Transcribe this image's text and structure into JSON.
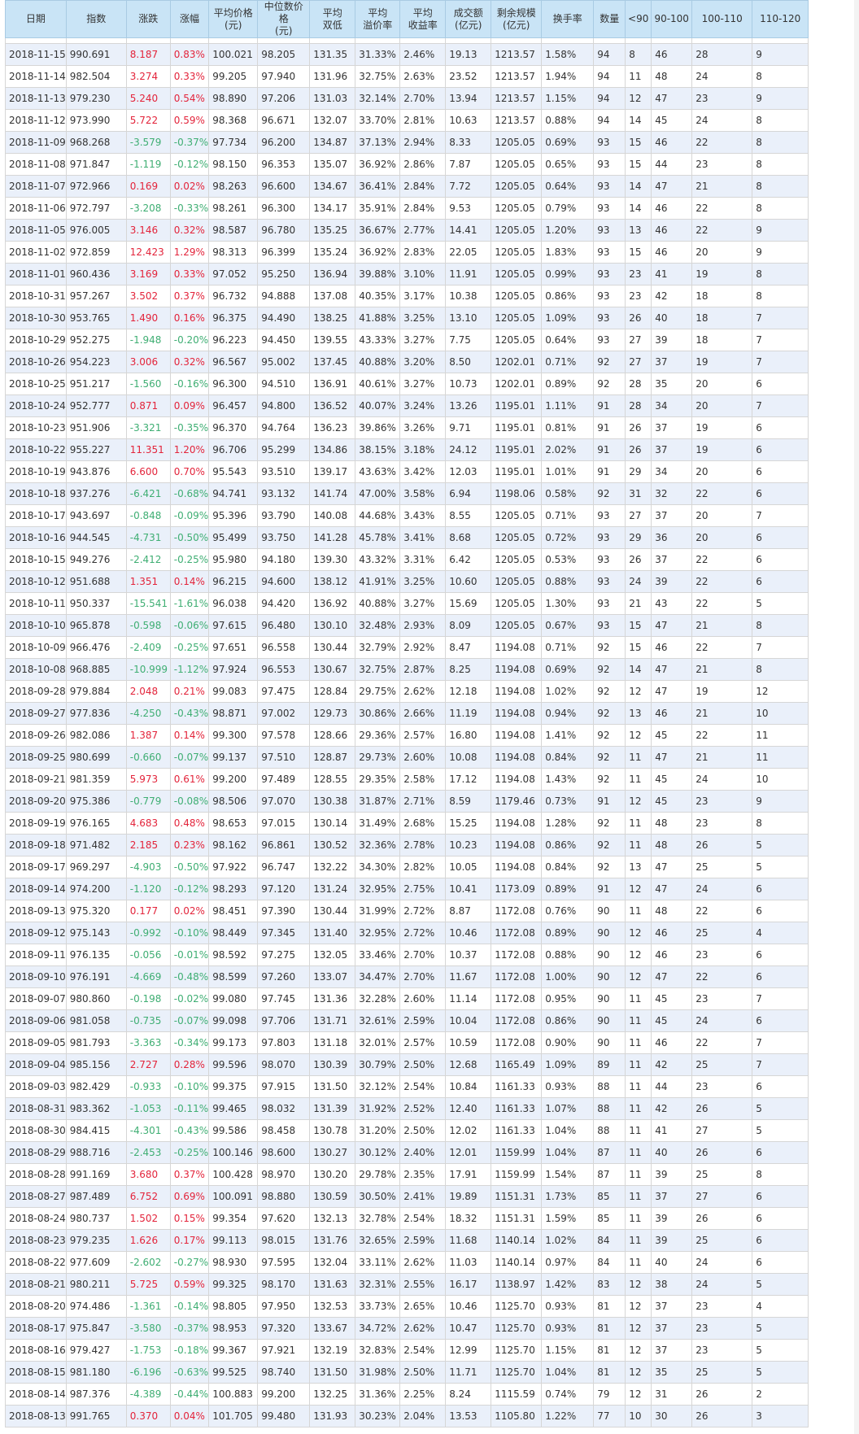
{
  "headers": [
    "日期",
    "指数",
    "涨跌",
    "涨幅",
    "平均价格\n(元)",
    "中位数价格\n(元)",
    "平均\n双低",
    "平均\n溢价率",
    "平均\n收益率",
    "成交额\n(亿元)",
    "剩余规模\n(亿元)",
    "换手率",
    "数量",
    "<90",
    "90-100",
    "100-110",
    "110-120"
  ],
  "rows": [
    [
      "2018-11-15",
      "990.691",
      "8.187",
      "0.83%",
      "100.021",
      "98.205",
      "131.35",
      "31.33%",
      "2.46%",
      "19.13",
      "1213.57",
      "1.58%",
      "94",
      "8",
      "46",
      "28",
      "9"
    ],
    [
      "2018-11-14",
      "982.504",
      "3.274",
      "0.33%",
      "99.205",
      "97.940",
      "131.96",
      "32.75%",
      "2.63%",
      "23.52",
      "1213.57",
      "1.94%",
      "94",
      "11",
      "48",
      "24",
      "8"
    ],
    [
      "2018-11-13",
      "979.230",
      "5.240",
      "0.54%",
      "98.890",
      "97.206",
      "131.03",
      "32.14%",
      "2.70%",
      "13.94",
      "1213.57",
      "1.15%",
      "94",
      "12",
      "47",
      "23",
      "9"
    ],
    [
      "2018-11-12",
      "973.990",
      "5.722",
      "0.59%",
      "98.368",
      "96.671",
      "132.07",
      "33.70%",
      "2.81%",
      "10.63",
      "1213.57",
      "0.88%",
      "94",
      "14",
      "45",
      "24",
      "8"
    ],
    [
      "2018-11-09",
      "968.268",
      "-3.579",
      "-0.37%",
      "97.734",
      "96.200",
      "134.87",
      "37.13%",
      "2.94%",
      "8.33",
      "1205.05",
      "0.69%",
      "93",
      "15",
      "46",
      "22",
      "8"
    ],
    [
      "2018-11-08",
      "971.847",
      "-1.119",
      "-0.12%",
      "98.150",
      "96.353",
      "135.07",
      "36.92%",
      "2.86%",
      "7.87",
      "1205.05",
      "0.65%",
      "93",
      "15",
      "44",
      "23",
      "8"
    ],
    [
      "2018-11-07",
      "972.966",
      "0.169",
      "0.02%",
      "98.263",
      "96.600",
      "134.67",
      "36.41%",
      "2.84%",
      "7.72",
      "1205.05",
      "0.64%",
      "93",
      "14",
      "47",
      "21",
      "8"
    ],
    [
      "2018-11-06",
      "972.797",
      "-3.208",
      "-0.33%",
      "98.261",
      "96.300",
      "134.17",
      "35.91%",
      "2.84%",
      "9.53",
      "1205.05",
      "0.79%",
      "93",
      "14",
      "46",
      "22",
      "8"
    ],
    [
      "2018-11-05",
      "976.005",
      "3.146",
      "0.32%",
      "98.587",
      "96.780",
      "135.25",
      "36.67%",
      "2.77%",
      "14.41",
      "1205.05",
      "1.20%",
      "93",
      "13",
      "46",
      "22",
      "9"
    ],
    [
      "2018-11-02",
      "972.859",
      "12.423",
      "1.29%",
      "98.313",
      "96.399",
      "135.24",
      "36.92%",
      "2.83%",
      "22.05",
      "1205.05",
      "1.83%",
      "93",
      "15",
      "46",
      "20",
      "9"
    ],
    [
      "2018-11-01",
      "960.436",
      "3.169",
      "0.33%",
      "97.052",
      "95.250",
      "136.94",
      "39.88%",
      "3.10%",
      "11.91",
      "1205.05",
      "0.99%",
      "93",
      "23",
      "41",
      "19",
      "8"
    ],
    [
      "2018-10-31",
      "957.267",
      "3.502",
      "0.37%",
      "96.732",
      "94.888",
      "137.08",
      "40.35%",
      "3.17%",
      "10.38",
      "1205.05",
      "0.86%",
      "93",
      "23",
      "42",
      "18",
      "8"
    ],
    [
      "2018-10-30",
      "953.765",
      "1.490",
      "0.16%",
      "96.375",
      "94.490",
      "138.25",
      "41.88%",
      "3.25%",
      "13.10",
      "1205.05",
      "1.09%",
      "93",
      "26",
      "40",
      "18",
      "7"
    ],
    [
      "2018-10-29",
      "952.275",
      "-1.948",
      "-0.20%",
      "96.223",
      "94.450",
      "139.55",
      "43.33%",
      "3.27%",
      "7.75",
      "1205.05",
      "0.64%",
      "93",
      "27",
      "39",
      "18",
      "7"
    ],
    [
      "2018-10-26",
      "954.223",
      "3.006",
      "0.32%",
      "96.567",
      "95.002",
      "137.45",
      "40.88%",
      "3.20%",
      "8.50",
      "1202.01",
      "0.71%",
      "92",
      "27",
      "37",
      "19",
      "7"
    ],
    [
      "2018-10-25",
      "951.217",
      "-1.560",
      "-0.16%",
      "96.300",
      "94.510",
      "136.91",
      "40.61%",
      "3.27%",
      "10.73",
      "1202.01",
      "0.89%",
      "92",
      "28",
      "35",
      "20",
      "6"
    ],
    [
      "2018-10-24",
      "952.777",
      "0.871",
      "0.09%",
      "96.457",
      "94.800",
      "136.52",
      "40.07%",
      "3.24%",
      "13.26",
      "1195.01",
      "1.11%",
      "91",
      "28",
      "34",
      "20",
      "7"
    ],
    [
      "2018-10-23",
      "951.906",
      "-3.321",
      "-0.35%",
      "96.370",
      "94.764",
      "136.23",
      "39.86%",
      "3.26%",
      "9.71",
      "1195.01",
      "0.81%",
      "91",
      "26",
      "37",
      "19",
      "6"
    ],
    [
      "2018-10-22",
      "955.227",
      "11.351",
      "1.20%",
      "96.706",
      "95.299",
      "134.86",
      "38.15%",
      "3.18%",
      "24.12",
      "1195.01",
      "2.02%",
      "91",
      "26",
      "37",
      "19",
      "6"
    ],
    [
      "2018-10-19",
      "943.876",
      "6.600",
      "0.70%",
      "95.543",
      "93.510",
      "139.17",
      "43.63%",
      "3.42%",
      "12.03",
      "1195.01",
      "1.01%",
      "91",
      "29",
      "34",
      "20",
      "6"
    ],
    [
      "2018-10-18",
      "937.276",
      "-6.421",
      "-0.68%",
      "94.741",
      "93.132",
      "141.74",
      "47.00%",
      "3.58%",
      "6.94",
      "1198.06",
      "0.58%",
      "92",
      "31",
      "32",
      "22",
      "6"
    ],
    [
      "2018-10-17",
      "943.697",
      "-0.848",
      "-0.09%",
      "95.396",
      "93.790",
      "140.08",
      "44.68%",
      "3.43%",
      "8.55",
      "1205.05",
      "0.71%",
      "93",
      "27",
      "37",
      "20",
      "7"
    ],
    [
      "2018-10-16",
      "944.545",
      "-4.731",
      "-0.50%",
      "95.499",
      "93.750",
      "141.28",
      "45.78%",
      "3.41%",
      "8.68",
      "1205.05",
      "0.72%",
      "93",
      "29",
      "36",
      "20",
      "6"
    ],
    [
      "2018-10-15",
      "949.276",
      "-2.412",
      "-0.25%",
      "95.980",
      "94.180",
      "139.30",
      "43.32%",
      "3.31%",
      "6.42",
      "1205.05",
      "0.53%",
      "93",
      "26",
      "37",
      "22",
      "6"
    ],
    [
      "2018-10-12",
      "951.688",
      "1.351",
      "0.14%",
      "96.215",
      "94.600",
      "138.12",
      "41.91%",
      "3.25%",
      "10.60",
      "1205.05",
      "0.88%",
      "93",
      "24",
      "39",
      "22",
      "6"
    ],
    [
      "2018-10-11",
      "950.337",
      "-15.541",
      "-1.61%",
      "96.038",
      "94.420",
      "136.92",
      "40.88%",
      "3.27%",
      "15.69",
      "1205.05",
      "1.30%",
      "93",
      "21",
      "43",
      "22",
      "5"
    ],
    [
      "2018-10-10",
      "965.878",
      "-0.598",
      "-0.06%",
      "97.615",
      "96.480",
      "130.10",
      "32.48%",
      "2.93%",
      "8.09",
      "1205.05",
      "0.67%",
      "93",
      "15",
      "47",
      "21",
      "8"
    ],
    [
      "2018-10-09",
      "966.476",
      "-2.409",
      "-0.25%",
      "97.651",
      "96.558",
      "130.44",
      "32.79%",
      "2.92%",
      "8.47",
      "1194.08",
      "0.71%",
      "92",
      "15",
      "46",
      "22",
      "7"
    ],
    [
      "2018-10-08",
      "968.885",
      "-10.999",
      "-1.12%",
      "97.924",
      "96.553",
      "130.67",
      "32.75%",
      "2.87%",
      "8.25",
      "1194.08",
      "0.69%",
      "92",
      "14",
      "47",
      "21",
      "8"
    ],
    [
      "2018-09-28",
      "979.884",
      "2.048",
      "0.21%",
      "99.083",
      "97.475",
      "128.84",
      "29.75%",
      "2.62%",
      "12.18",
      "1194.08",
      "1.02%",
      "92",
      "12",
      "47",
      "19",
      "12"
    ],
    [
      "2018-09-27",
      "977.836",
      "-4.250",
      "-0.43%",
      "98.871",
      "97.002",
      "129.73",
      "30.86%",
      "2.66%",
      "11.19",
      "1194.08",
      "0.94%",
      "92",
      "13",
      "46",
      "21",
      "10"
    ],
    [
      "2018-09-26",
      "982.086",
      "1.387",
      "0.14%",
      "99.300",
      "97.578",
      "128.66",
      "29.36%",
      "2.57%",
      "16.80",
      "1194.08",
      "1.41%",
      "92",
      "12",
      "45",
      "22",
      "11"
    ],
    [
      "2018-09-25",
      "980.699",
      "-0.660",
      "-0.07%",
      "99.137",
      "97.510",
      "128.87",
      "29.73%",
      "2.60%",
      "10.08",
      "1194.08",
      "0.84%",
      "92",
      "11",
      "47",
      "21",
      "11"
    ],
    [
      "2018-09-21",
      "981.359",
      "5.973",
      "0.61%",
      "99.200",
      "97.489",
      "128.55",
      "29.35%",
      "2.58%",
      "17.12",
      "1194.08",
      "1.43%",
      "92",
      "11",
      "45",
      "24",
      "10"
    ],
    [
      "2018-09-20",
      "975.386",
      "-0.779",
      "-0.08%",
      "98.506",
      "97.070",
      "130.38",
      "31.87%",
      "2.71%",
      "8.59",
      "1179.46",
      "0.73%",
      "91",
      "12",
      "45",
      "23",
      "9"
    ],
    [
      "2018-09-19",
      "976.165",
      "4.683",
      "0.48%",
      "98.653",
      "97.015",
      "130.14",
      "31.49%",
      "2.68%",
      "15.25",
      "1194.08",
      "1.28%",
      "92",
      "11",
      "48",
      "23",
      "8"
    ],
    [
      "2018-09-18",
      "971.482",
      "2.185",
      "0.23%",
      "98.162",
      "96.861",
      "130.52",
      "32.36%",
      "2.78%",
      "10.23",
      "1194.08",
      "0.86%",
      "92",
      "11",
      "48",
      "26",
      "5"
    ],
    [
      "2018-09-17",
      "969.297",
      "-4.903",
      "-0.50%",
      "97.922",
      "96.747",
      "132.22",
      "34.30%",
      "2.82%",
      "10.05",
      "1194.08",
      "0.84%",
      "92",
      "13",
      "47",
      "25",
      "5"
    ],
    [
      "2018-09-14",
      "974.200",
      "-1.120",
      "-0.12%",
      "98.293",
      "97.120",
      "131.24",
      "32.95%",
      "2.75%",
      "10.41",
      "1173.09",
      "0.89%",
      "91",
      "12",
      "47",
      "24",
      "6"
    ],
    [
      "2018-09-13",
      "975.320",
      "0.177",
      "0.02%",
      "98.451",
      "97.390",
      "130.44",
      "31.99%",
      "2.72%",
      "8.87",
      "1172.08",
      "0.76%",
      "90",
      "11",
      "48",
      "22",
      "6"
    ],
    [
      "2018-09-12",
      "975.143",
      "-0.992",
      "-0.10%",
      "98.449",
      "97.345",
      "131.40",
      "32.95%",
      "2.72%",
      "10.46",
      "1172.08",
      "0.89%",
      "90",
      "12",
      "46",
      "25",
      "4"
    ],
    [
      "2018-09-11",
      "976.135",
      "-0.056",
      "-0.01%",
      "98.592",
      "97.275",
      "132.05",
      "33.46%",
      "2.70%",
      "10.37",
      "1172.08",
      "0.88%",
      "90",
      "12",
      "46",
      "23",
      "6"
    ],
    [
      "2018-09-10",
      "976.191",
      "-4.669",
      "-0.48%",
      "98.599",
      "97.260",
      "133.07",
      "34.47%",
      "2.70%",
      "11.67",
      "1172.08",
      "1.00%",
      "90",
      "12",
      "47",
      "22",
      "6"
    ],
    [
      "2018-09-07",
      "980.860",
      "-0.198",
      "-0.02%",
      "99.080",
      "97.745",
      "131.36",
      "32.28%",
      "2.60%",
      "11.14",
      "1172.08",
      "0.95%",
      "90",
      "11",
      "45",
      "23",
      "7"
    ],
    [
      "2018-09-06",
      "981.058",
      "-0.735",
      "-0.07%",
      "99.098",
      "97.706",
      "131.71",
      "32.61%",
      "2.59%",
      "10.04",
      "1172.08",
      "0.86%",
      "90",
      "11",
      "45",
      "24",
      "6"
    ],
    [
      "2018-09-05",
      "981.793",
      "-3.363",
      "-0.34%",
      "99.173",
      "97.803",
      "131.18",
      "32.01%",
      "2.57%",
      "10.59",
      "1172.08",
      "0.90%",
      "90",
      "11",
      "46",
      "22",
      "7"
    ],
    [
      "2018-09-04",
      "985.156",
      "2.727",
      "0.28%",
      "99.596",
      "98.070",
      "130.39",
      "30.79%",
      "2.50%",
      "12.68",
      "1165.49",
      "1.09%",
      "89",
      "11",
      "42",
      "25",
      "7"
    ],
    [
      "2018-09-03",
      "982.429",
      "-0.933",
      "-0.10%",
      "99.375",
      "97.915",
      "131.50",
      "32.12%",
      "2.54%",
      "10.84",
      "1161.33",
      "0.93%",
      "88",
      "11",
      "44",
      "23",
      "6"
    ],
    [
      "2018-08-31",
      "983.362",
      "-1.053",
      "-0.11%",
      "99.465",
      "98.032",
      "131.39",
      "31.92%",
      "2.52%",
      "12.40",
      "1161.33",
      "1.07%",
      "88",
      "11",
      "42",
      "26",
      "5"
    ],
    [
      "2018-08-30",
      "984.415",
      "-4.301",
      "-0.43%",
      "99.586",
      "98.458",
      "130.78",
      "31.20%",
      "2.50%",
      "12.02",
      "1161.33",
      "1.04%",
      "88",
      "11",
      "41",
      "27",
      "5"
    ],
    [
      "2018-08-29",
      "988.716",
      "-2.453",
      "-0.25%",
      "100.146",
      "98.600",
      "130.27",
      "30.12%",
      "2.40%",
      "12.01",
      "1159.99",
      "1.04%",
      "87",
      "11",
      "40",
      "26",
      "6"
    ],
    [
      "2018-08-28",
      "991.169",
      "3.680",
      "0.37%",
      "100.428",
      "98.970",
      "130.20",
      "29.78%",
      "2.35%",
      "17.91",
      "1159.99",
      "1.54%",
      "87",
      "11",
      "39",
      "25",
      "8"
    ],
    [
      "2018-08-27",
      "987.489",
      "6.752",
      "0.69%",
      "100.091",
      "98.880",
      "130.59",
      "30.50%",
      "2.41%",
      "19.89",
      "1151.31",
      "1.73%",
      "85",
      "11",
      "37",
      "27",
      "6"
    ],
    [
      "2018-08-24",
      "980.737",
      "1.502",
      "0.15%",
      "99.354",
      "97.620",
      "132.13",
      "32.78%",
      "2.54%",
      "18.32",
      "1151.31",
      "1.59%",
      "85",
      "11",
      "39",
      "26",
      "6"
    ],
    [
      "2018-08-23",
      "979.235",
      "1.626",
      "0.17%",
      "99.113",
      "98.015",
      "131.76",
      "32.65%",
      "2.59%",
      "11.68",
      "1140.14",
      "1.02%",
      "84",
      "11",
      "39",
      "25",
      "6"
    ],
    [
      "2018-08-22",
      "977.609",
      "-2.602",
      "-0.27%",
      "98.930",
      "97.595",
      "132.04",
      "33.11%",
      "2.62%",
      "11.03",
      "1140.14",
      "0.97%",
      "84",
      "11",
      "40",
      "24",
      "6"
    ],
    [
      "2018-08-21",
      "980.211",
      "5.725",
      "0.59%",
      "99.325",
      "98.170",
      "131.63",
      "32.31%",
      "2.55%",
      "16.17",
      "1138.97",
      "1.42%",
      "83",
      "12",
      "38",
      "24",
      "5"
    ],
    [
      "2018-08-20",
      "974.486",
      "-1.361",
      "-0.14%",
      "98.805",
      "97.950",
      "132.53",
      "33.73%",
      "2.65%",
      "10.46",
      "1125.70",
      "0.93%",
      "81",
      "12",
      "37",
      "23",
      "4"
    ],
    [
      "2018-08-17",
      "975.847",
      "-3.580",
      "-0.37%",
      "98.953",
      "97.320",
      "133.67",
      "34.72%",
      "2.62%",
      "10.47",
      "1125.70",
      "0.93%",
      "81",
      "12",
      "37",
      "23",
      "5"
    ],
    [
      "2018-08-16",
      "979.427",
      "-1.753",
      "-0.18%",
      "99.367",
      "97.921",
      "132.19",
      "32.83%",
      "2.54%",
      "12.99",
      "1125.70",
      "1.15%",
      "81",
      "12",
      "37",
      "23",
      "5"
    ],
    [
      "2018-08-15",
      "981.180",
      "-6.196",
      "-0.63%",
      "99.525",
      "98.740",
      "131.50",
      "31.98%",
      "2.50%",
      "11.71",
      "1125.70",
      "1.04%",
      "81",
      "12",
      "35",
      "25",
      "5"
    ],
    [
      "2018-08-14",
      "987.376",
      "-4.389",
      "-0.44%",
      "100.883",
      "99.200",
      "132.25",
      "31.36%",
      "2.25%",
      "8.24",
      "1115.59",
      "0.74%",
      "79",
      "12",
      "31",
      "26",
      "2"
    ],
    [
      "2018-08-13",
      "991.765",
      "0.370",
      "0.04%",
      "101.705",
      "99.480",
      "131.93",
      "30.23%",
      "2.04%",
      "13.53",
      "1105.80",
      "1.22%",
      "77",
      "10",
      "30",
      "26",
      "3"
    ]
  ],
  "colors": {
    "up": "#e3243b",
    "down": "#3fae73",
    "header_bg": "#c9e4f6",
    "stripe": "#eaf0fa"
  }
}
